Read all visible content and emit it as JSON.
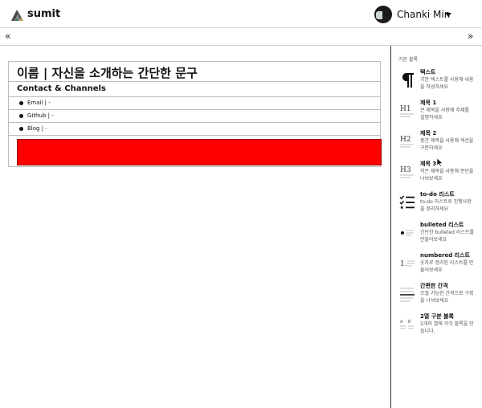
{
  "header": {
    "brand": "sumit",
    "user_name": "Chanki Min"
  },
  "toolbar": {
    "collapse_left": "«",
    "collapse_right": "»"
  },
  "editor": {
    "title": "이름 | 자신을 소개하는 간단한 문구",
    "subtitle": "Contact & Channels",
    "items": [
      "Email | -",
      "Github | -",
      "Blog | -"
    ],
    "highlight_color": "#ff0000"
  },
  "sidebar": {
    "title": "기본 블록",
    "blocks": [
      {
        "name": "텍스트",
        "desc": "기본 텍스트를 사용해 내용을 작성하세요",
        "icon": "paragraph-icon"
      },
      {
        "name": "제목 1",
        "desc": "큰 제목을 사용해 주제를 설명하세요",
        "icon": "h1-icon"
      },
      {
        "name": "제목 2",
        "desc": "중간 제목을 사용해 섹션을 구분하세요",
        "icon": "h2-icon"
      },
      {
        "name": "제목 3",
        "desc": "작은 제목을 사용해 문단을 나눠보세요",
        "icon": "h3-icon"
      },
      {
        "name": "to-do 리스트",
        "desc": "to-do 리스트로 진행사항을 정리하세요",
        "icon": "todo-icon"
      },
      {
        "name": "bulleted 리스트",
        "desc": "간단한 bulleted 리스트를 만들어보세요",
        "icon": "bulleted-list-icon"
      },
      {
        "name": "numbered 리스트",
        "desc": "숫자로 정리된 리스트를 만들어보세요",
        "icon": "numbered-list-icon"
      },
      {
        "name": "간편한 간격",
        "desc": "조절 가능한 간격으로 구획을 나눠보세요",
        "icon": "spacer-icon"
      },
      {
        "name": "2열 구분 블록",
        "desc": "2개의 열에 각각 블록을 만듭니다.",
        "icon": "two-column-icon"
      }
    ]
  }
}
